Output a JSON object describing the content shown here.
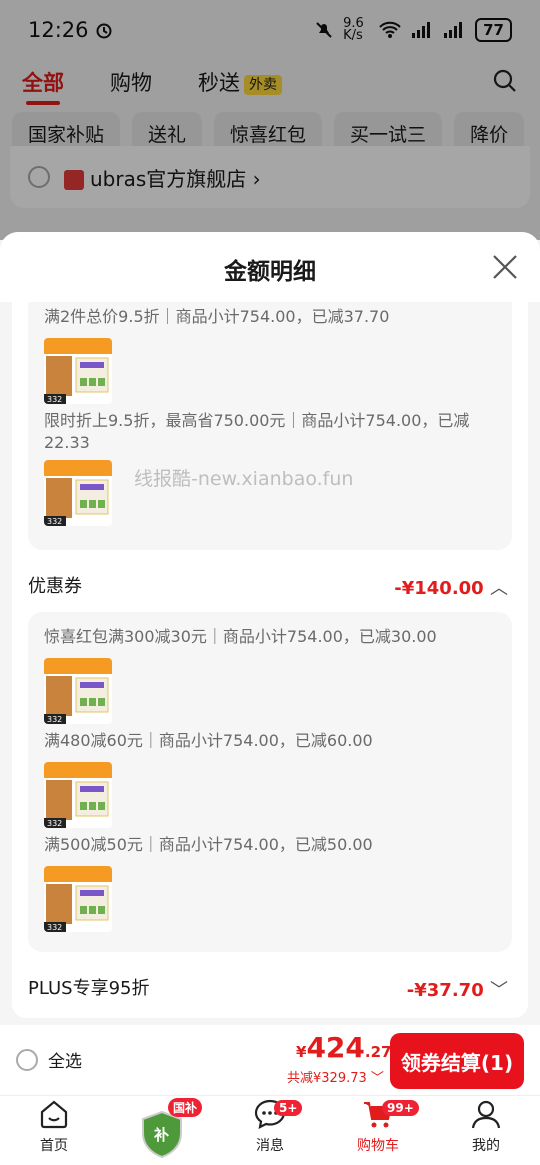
{
  "status": {
    "time": "12:26",
    "net_speed": "9.6 K/s",
    "battery": "77"
  },
  "topnav": {
    "tabs": [
      "全部",
      "购物",
      "秒送"
    ],
    "waimai_badge": "外卖"
  },
  "chips": [
    "国家补贴",
    "送礼",
    "惊喜红包",
    "买一试三",
    "降价"
  ],
  "shop": {
    "name": "ubras官方旗舰店",
    "chevron": "›"
  },
  "sheet": {
    "title": "金额明细",
    "watermark": "线报酷-new.xianbao.fun",
    "promo_lines": [
      {
        "text": "满2件总价9.5折｜商品小计754.00，已减37.70"
      },
      {
        "text": "限时折上9.5折，最高省750.00元｜商品小计754.00，已减",
        "text2": "22.33"
      }
    ],
    "coupon": {
      "title": "优惠券",
      "amount": "-¥140.00",
      "lines": [
        "惊喜红包满300减30元｜商品小计754.00，已减30.00",
        "满480减60元｜商品小计754.00，已减60.00",
        "满500减50元｜商品小计754.00，已减50.00"
      ]
    },
    "plus": {
      "title": "PLUS专享95折",
      "amount": "-¥37.70"
    },
    "thumb_label": "332"
  },
  "checkout": {
    "select_all": "全选",
    "currency": "¥",
    "price_int": "424",
    "price_dec": ".27",
    "saved": "共减¥329.73",
    "button": "领券结算(1)"
  },
  "tabbar": [
    {
      "label": "首页",
      "icon": "home-icon"
    },
    {
      "label": "",
      "icon": "subsidy-shield-icon",
      "badge": "国补"
    },
    {
      "label": "消息",
      "icon": "message-icon",
      "badge": "5+"
    },
    {
      "label": "购物车",
      "icon": "cart-icon",
      "badge": "99+"
    },
    {
      "label": "我的",
      "icon": "profile-icon"
    }
  ],
  "colors": {
    "accent": "#e11c1c",
    "button": "#e8121d",
    "badge_yellow": "#ffd93a"
  }
}
